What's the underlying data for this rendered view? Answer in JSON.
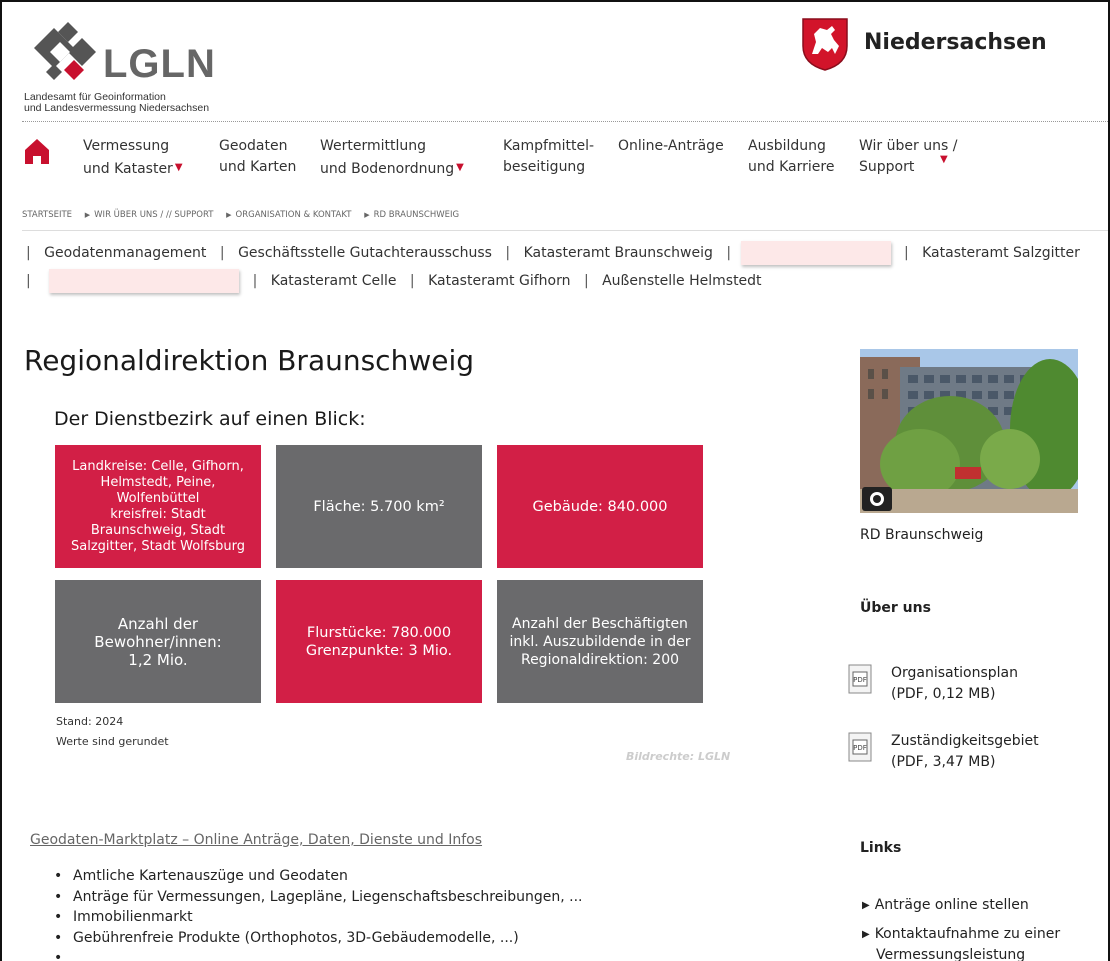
{
  "header": {
    "logo_text": "LGLN",
    "logo_sub_line1": "Landesamt für Geoinformation",
    "logo_sub_line2": "und Landesvermessung Niedersachsen",
    "state_name": "Niedersachsen"
  },
  "nav": {
    "items": [
      {
        "line1": "Vermessung",
        "line2": "und Kataster",
        "dropdown": true
      },
      {
        "line1": "Geodaten",
        "line2": "und Karten",
        "dropdown": false
      },
      {
        "line1": "Wertermittlung",
        "line2": "und Bodenordnung",
        "dropdown": true
      },
      {
        "line1": "Kampfmittel-",
        "line2": "beseitigung",
        "dropdown": false
      },
      {
        "line1": "Online-Anträge",
        "line2": "",
        "dropdown": false
      },
      {
        "line1": "Ausbildung",
        "line2": "und Karriere",
        "dropdown": false
      },
      {
        "line1": "Wir über uns /",
        "line2": "Support",
        "dropdown": true
      }
    ]
  },
  "breadcrumb": [
    "STARTSEITE",
    "WIR ÜBER UNS / // SUPPORT",
    "ORGANISATION & KONTAKT",
    "RD BRAUNSCHWEIG"
  ],
  "subnav": {
    "row1": [
      "Geodatenmanagement",
      "Geschäftsstelle Gutachterausschuss",
      "Katasteramt Braunschweig",
      "",
      "Katasteramt Salzgitter"
    ],
    "row2": [
      "",
      "Katasteramt Celle",
      "Katasteramt Gifhorn",
      "Außenstelle Helmstedt"
    ]
  },
  "main": {
    "title": "Regionaldirektion Braunschweig",
    "section_title": "Der Dienstbezirk auf einen Blick:",
    "tiles": [
      {
        "text": "Landkreise: Celle, Gifhorn,\nHelmstedt, Peine,\nWolfenbüttel\nkreisfrei: Stadt\nBraunschweig, Stadt\nSalzgitter, Stadt Wolfsburg",
        "color": "#d21f46"
      },
      {
        "text": "Fläche: 5.700 km²",
        "color": "#6a6a6c"
      },
      {
        "text": "Gebäude: 840.000",
        "color": "#d21f46"
      },
      {
        "text": "Anzahl der\nBewohner/innen:\n1,2 Mio.",
        "color": "#6a6a6c"
      },
      {
        "text": "Flurstücke: 780.000\nGrenzpunkte: 3 Mio.",
        "color": "#d21f46"
      },
      {
        "text": "Anzahl der Beschäftigten\ninkl. Auszubildende in der\nRegionaldirektion: 200",
        "color": "#6a6a6c"
      }
    ],
    "stand": "Stand: 2024",
    "gerundet": "Werte sind gerundet",
    "watermark": "Bildrechte: LGLN",
    "geo_link": "Geodaten-Marktplatz – Online Anträge, Daten, Dienste und Infos",
    "bullets": [
      "Amtliche Kartenauszüge und Geodaten",
      "Anträge für Vermessungen, Lagepläne, Liegenschaftsbeschreibungen, ...",
      "Immobilienmarkt",
      "Gebührenfreie Produkte (Orthophotos, 3D-Gebäudemodelle, ...)",
      ""
    ]
  },
  "sidebar": {
    "photo_credit": "Bildrechte: LGLN",
    "photo_caption": "RD Braunschweig",
    "about_heading": "Über uns",
    "pdfs": [
      {
        "line1": "Organisationsplan",
        "line2": "(PDF, 0,12 MB)",
        "icon_label": "PDF"
      },
      {
        "line1": "Zuständigkeitsgebiet",
        "line2": "(PDF, 3,47 MB)",
        "icon_label": "PDF"
      }
    ],
    "links_heading": "Links",
    "links": [
      {
        "line1": "Anträge online stellen",
        "line2": ""
      },
      {
        "line1": "Kontaktaufnahme zu einer",
        "line2": "Vermessungsleistung"
      }
    ]
  },
  "colors": {
    "accent_red": "#d21f46",
    "tile_grey": "#6a6a6c",
    "nav_red": "#c8102e"
  }
}
